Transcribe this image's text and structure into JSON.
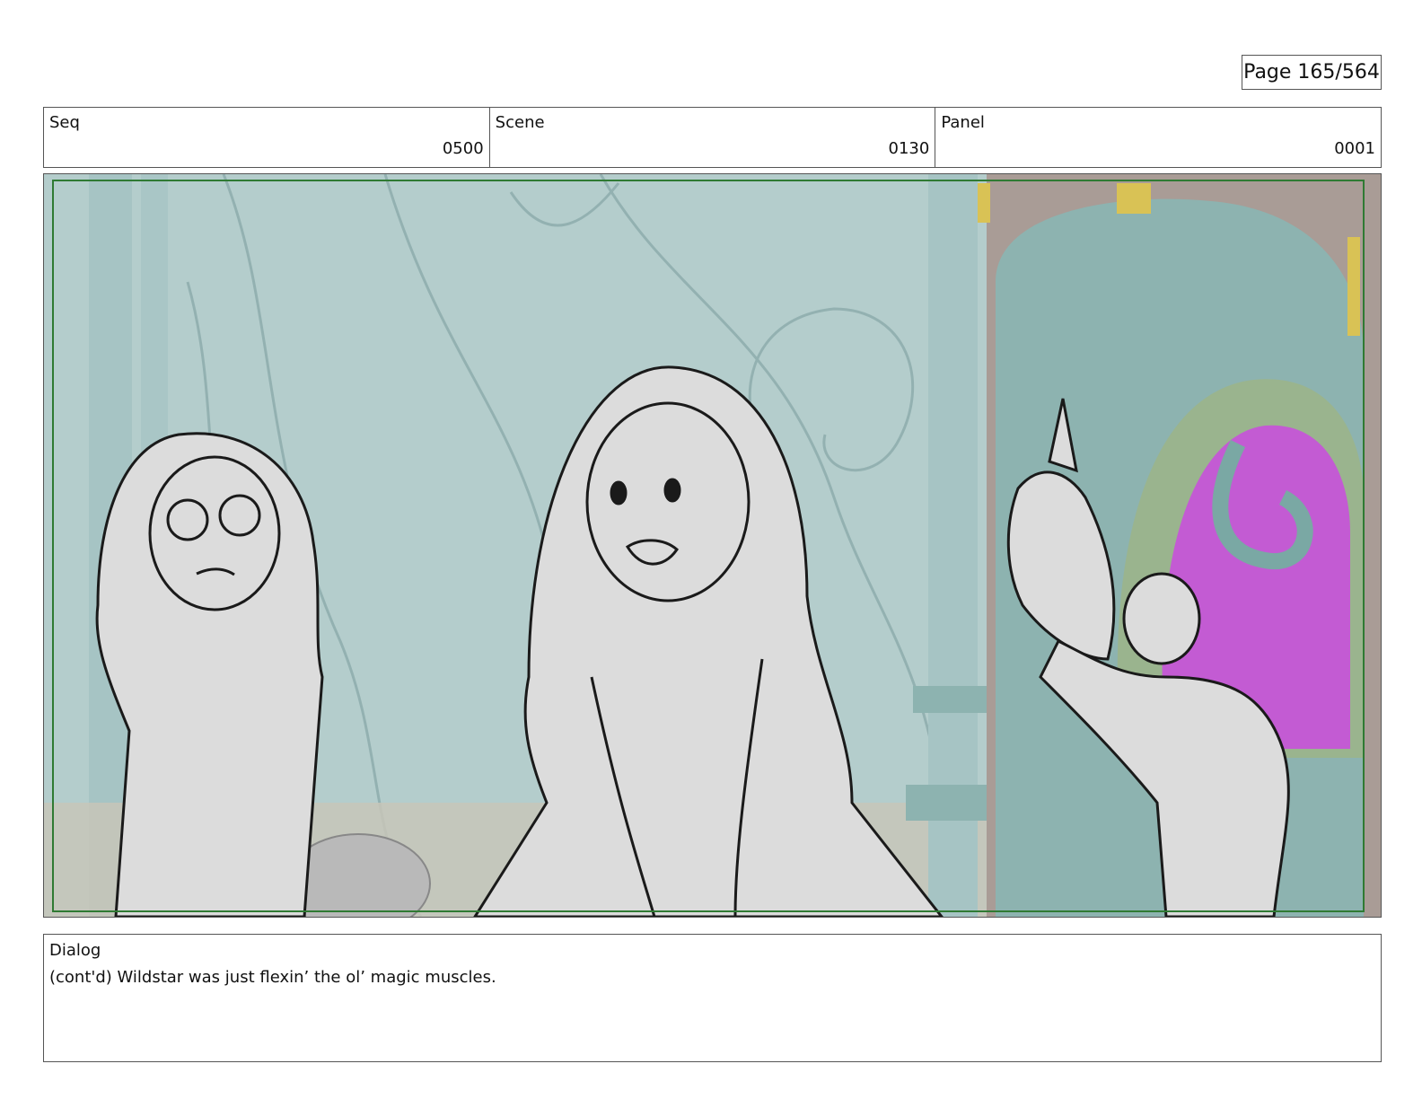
{
  "page": {
    "label": "Page 165/564"
  },
  "info": {
    "seq": {
      "label": "Seq",
      "value": "0500"
    },
    "scene": {
      "label": "Scene",
      "value": "0130"
    },
    "panel": {
      "label": "Panel",
      "value": "0001"
    }
  },
  "artwork": {
    "colors": {
      "wall": "#b4cdcc",
      "pillar": "#a6c4c4",
      "door_trim": "#8db3b0",
      "door_green": "#9ab48e",
      "portal": "#c35bd3",
      "gold": "#d9c255",
      "floor": "#c7c6b9",
      "safe_frame": "#2f7a33",
      "sketch_fill": "#dcdcdc",
      "sketch_line": "#1a1a1a"
    }
  },
  "dialog": {
    "label": "Dialog",
    "text": "(cont'd) Wildstar was just flexin’ the ol’ magic muscles."
  }
}
